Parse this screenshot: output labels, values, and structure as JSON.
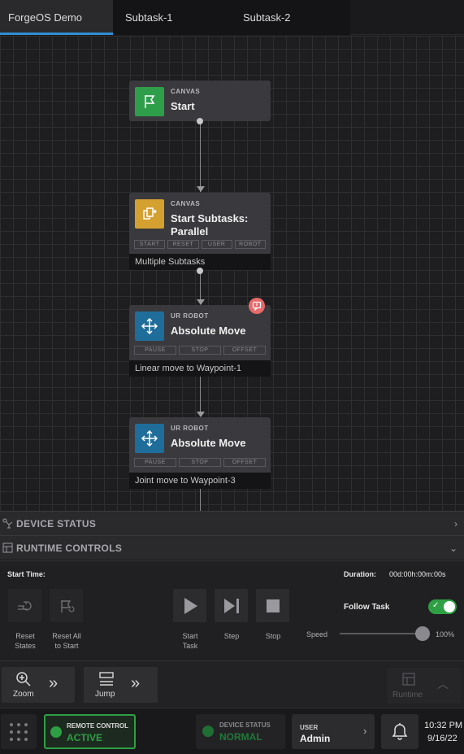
{
  "tabs": [
    {
      "label": "ForgeOS Demo",
      "active": true
    },
    {
      "label": "Subtask-1",
      "active": false
    },
    {
      "label": "Subtask-2",
      "active": false
    }
  ],
  "nodes": [
    {
      "category": "CANVAS",
      "title": "Start",
      "icon": "flag-icon",
      "color": "#2e9e4a"
    },
    {
      "category": "CANVAS",
      "title": "Start Subtasks:\nParallel",
      "icon": "subtasks-icon",
      "color": "#d4a030",
      "pills": [
        "START",
        "RESET",
        "USER",
        "ROBOT"
      ],
      "footer": "Multiple Subtasks"
    },
    {
      "category": "UR ROBOT",
      "title": "Absolute Move",
      "icon": "move-icon",
      "color": "#1f6d9a",
      "pills": [
        "PAUSE",
        "STOP",
        "OFFSET"
      ],
      "footer": "Linear move to Waypoint-1"
    },
    {
      "category": "UR ROBOT",
      "title": "Absolute Move",
      "icon": "move-icon",
      "color": "#1f6d9a",
      "pills": [
        "PAUSE",
        "STOP",
        "OFFSET"
      ],
      "footer": "Joint move to Waypoint-3"
    }
  ],
  "panels": {
    "device_status": "DEVICE STATUS",
    "runtime_controls": "RUNTIME CONTROLS"
  },
  "runtime": {
    "start_time_label": "Start Time:",
    "duration_label": "Duration:",
    "duration_value": "00d:00h:00m:00s",
    "reset_states": "Reset\nStates",
    "reset_all": "Reset All\nto Start",
    "start_task": "Start\nTask",
    "step": "Step",
    "stop": "Stop",
    "follow_task": "Follow Task",
    "follow_task_on": true,
    "speed_label": "Speed",
    "speed_value": "100%",
    "speed_fraction": 1.0
  },
  "toolbar": {
    "zoom": "Zoom",
    "jump": "Jump",
    "runtime": "Runtime"
  },
  "bottom": {
    "remote_control_label": "REMOTE CONTROL",
    "remote_control_value": "ACTIVE",
    "device_status_label": "DEVICE STATUS",
    "device_status_value": "NORMAL",
    "user_label": "USER",
    "user_value": "Admin",
    "time": "10:32 PM",
    "date": "9/16/22"
  },
  "colors": {
    "accent_blue": "#2f8fd4",
    "active_green": "#2ea043",
    "badge_red": "#e86a6a"
  }
}
